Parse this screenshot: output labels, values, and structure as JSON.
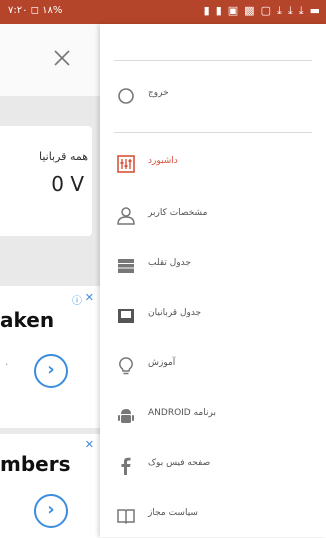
{
  "statusbar": {
    "left_text": "۷:۲۰ ◻ ۱۸%",
    "icons": [
      "battery-icon",
      "signal-icon",
      "signal-icon",
      "sim-icon",
      "4g-icon",
      "media-icon",
      "screenshot-icon",
      "download-icon",
      "download-icon",
      "download-icon",
      "message-icon"
    ]
  },
  "behind": {
    "card_label": "همه قربانیا",
    "card_value": "0 V",
    "ad1_text": "aken",
    "ad2_text": "mbers"
  },
  "drawer": {
    "items": [
      {
        "label": "خروج",
        "icon": "logout-circle-icon"
      },
      {
        "label": "داشبورد",
        "icon": "dashboard-icon"
      },
      {
        "label": "مشخصات کاربر",
        "icon": "user-profile-icon"
      },
      {
        "label": "جدول تقلب",
        "icon": "table-icon"
      },
      {
        "label": "جدول قربانیان",
        "icon": "victims-table-icon"
      },
      {
        "label": "آموزش",
        "icon": "lightbulb-icon"
      },
      {
        "label": "برنامه ANDROID",
        "icon": "android-icon"
      },
      {
        "label": "صفحه فیس بوک",
        "icon": "facebook-icon"
      },
      {
        "label": "سیاست مجاز",
        "icon": "book-icon"
      }
    ]
  },
  "colors": {
    "statusbar": "#b5452a",
    "accent": "#d8533a",
    "link": "#3b8de0"
  }
}
